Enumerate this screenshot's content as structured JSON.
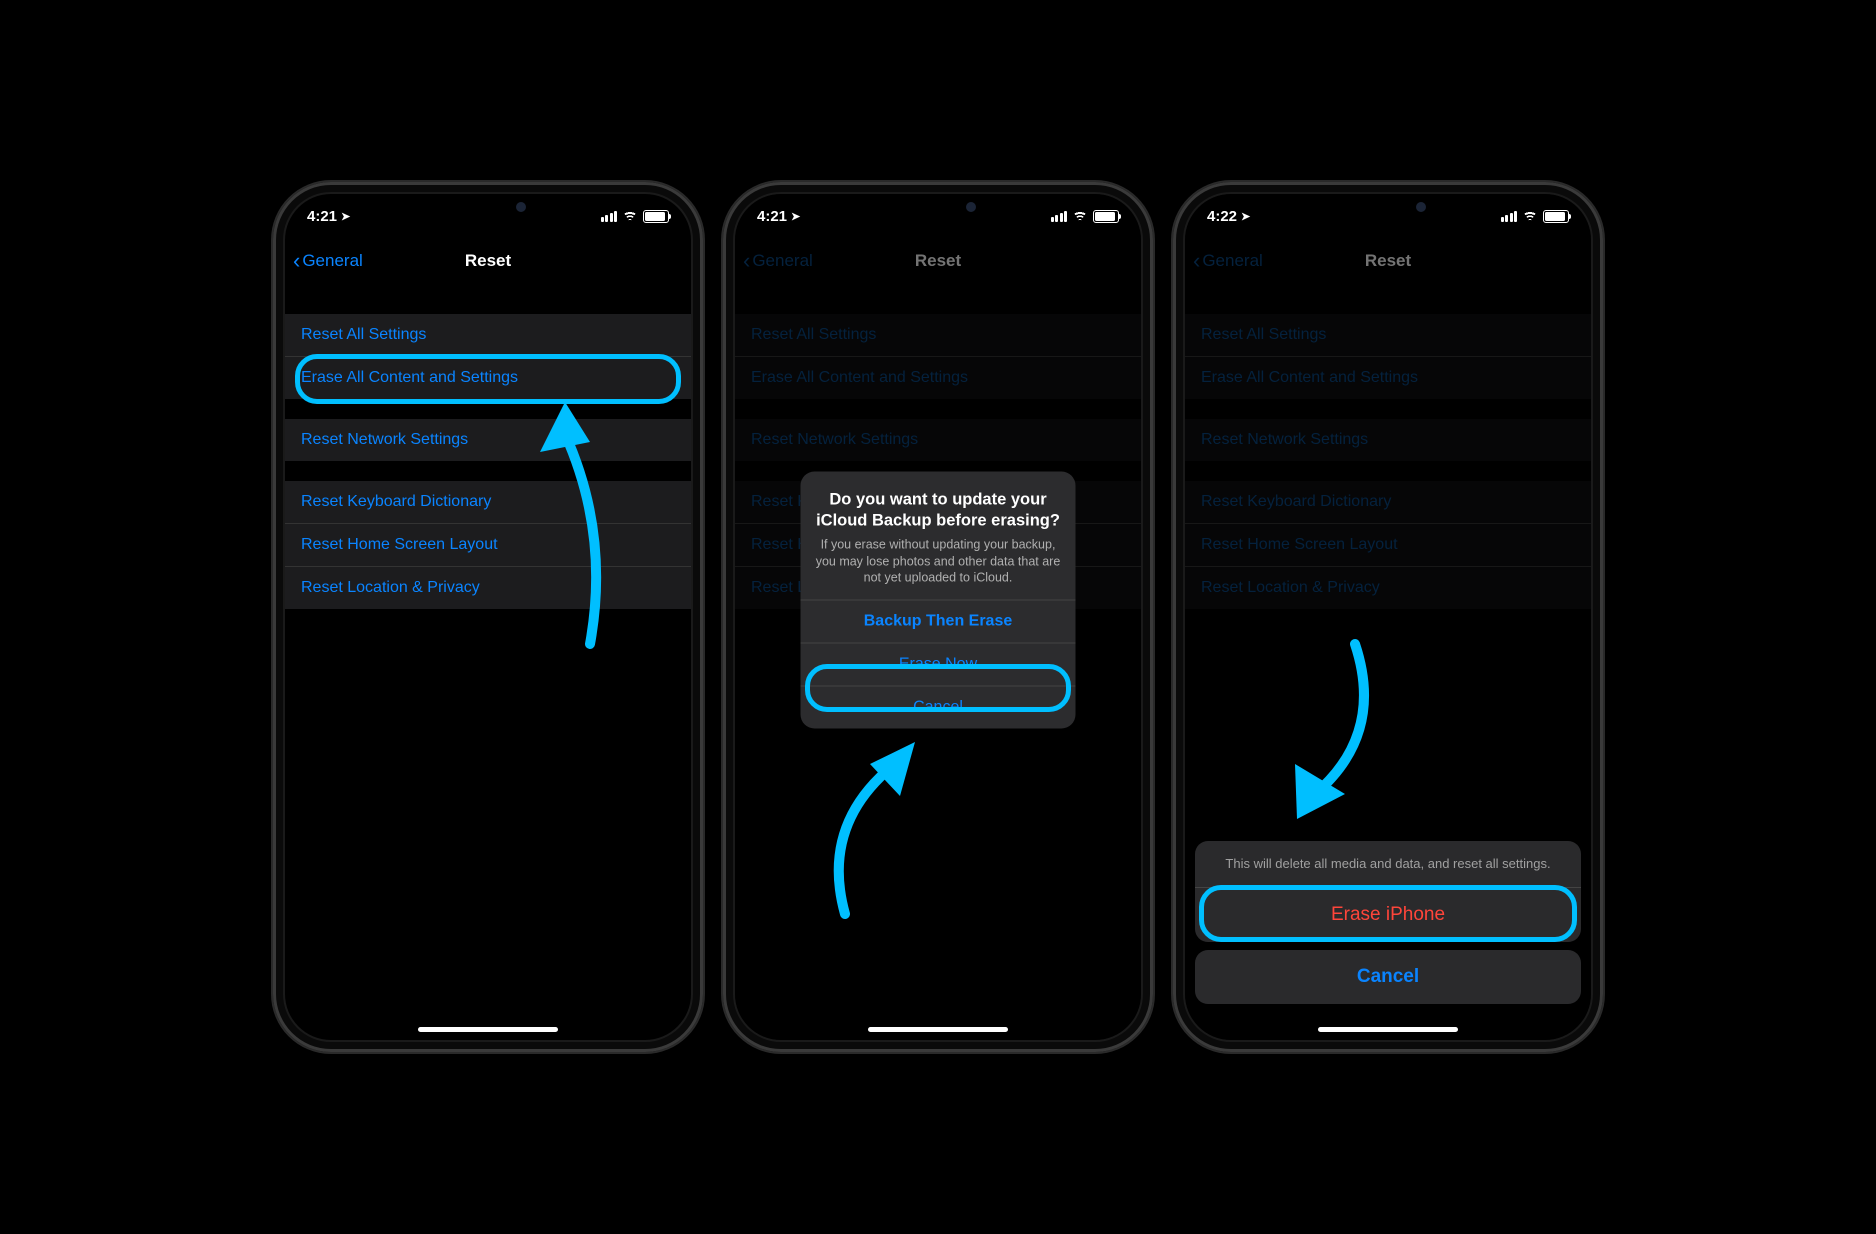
{
  "colors": {
    "accent": "#0a84ff",
    "highlight": "#00bfff",
    "destructive": "#ff453a"
  },
  "phone1": {
    "time": "4:21",
    "back_label": "General",
    "title": "Reset",
    "groups": [
      {
        "rows": [
          "Reset All Settings",
          "Erase All Content and Settings"
        ]
      },
      {
        "rows": [
          "Reset Network Settings"
        ]
      },
      {
        "rows": [
          "Reset Keyboard Dictionary",
          "Reset Home Screen Layout",
          "Reset Location & Privacy"
        ]
      }
    ]
  },
  "phone2": {
    "time": "4:21",
    "back_label": "General",
    "title": "Reset",
    "groups": [
      {
        "rows": [
          "Reset All Settings",
          "Erase All Content and Settings"
        ]
      },
      {
        "rows": [
          "Reset Network Settings"
        ]
      },
      {
        "rows": [
          "Reset Keyboard Dictionary",
          "Reset Home Screen Layout",
          "Reset Location & Privacy"
        ]
      }
    ],
    "alert": {
      "title": "Do you want to update your iCloud Backup before erasing?",
      "message": "If you erase without updating your backup, you may lose photos and other data that are not yet uploaded to iCloud.",
      "buttons": [
        "Backup Then Erase",
        "Erase Now",
        "Cancel"
      ]
    }
  },
  "phone3": {
    "time": "4:22",
    "back_label": "General",
    "title": "Reset",
    "groups": [
      {
        "rows": [
          "Reset All Settings",
          "Erase All Content and Settings"
        ]
      },
      {
        "rows": [
          "Reset Network Settings"
        ]
      },
      {
        "rows": [
          "Reset Keyboard Dictionary",
          "Reset Home Screen Layout",
          "Reset Location & Privacy"
        ]
      }
    ],
    "sheet": {
      "message": "This will delete all media and data, and reset all settings.",
      "destructive": "Erase iPhone",
      "cancel": "Cancel"
    }
  }
}
